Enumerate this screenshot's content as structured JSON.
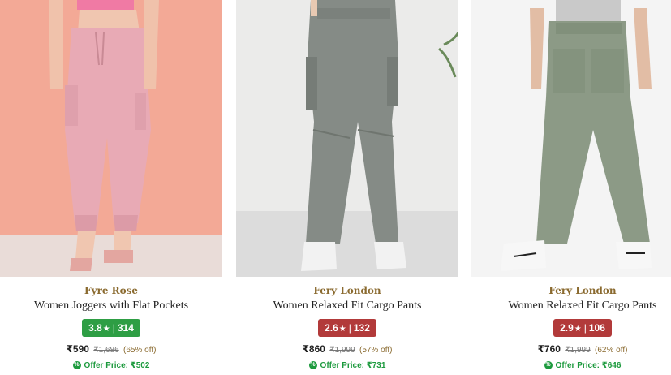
{
  "products": [
    {
      "brand": "Fyre Rose",
      "title": "Women Joggers with Flat Pockets",
      "rating": "3.8",
      "reviews": "314",
      "rating_color": "#2e9e44",
      "price": "₹590",
      "mrp": "₹1,686",
      "discount": "(65% off)",
      "offer": "Offer Price: ₹502"
    },
    {
      "brand": "Fery London",
      "title": "Women Relaxed Fit Cargo Pants",
      "rating": "2.6",
      "reviews": "132",
      "rating_color": "#b23a3a",
      "price": "₹860",
      "mrp": "₹1,999",
      "discount": "(57% off)",
      "offer": "Offer Price: ₹731"
    },
    {
      "brand": "Fery London",
      "title": "Women Relaxed Fit Cargo Pants",
      "rating": "2.9",
      "reviews": "106",
      "rating_color": "#b23a3a",
      "price": "₹760",
      "mrp": "₹1,999",
      "discount": "(62% off)",
      "offer": "Offer Price: ₹646"
    }
  ],
  "icons": {
    "rating_star": "star-icon",
    "offer_badge": "percent-badge-icon"
  },
  "symbols": {
    "star": "★",
    "separator": "|",
    "percent": "%"
  }
}
